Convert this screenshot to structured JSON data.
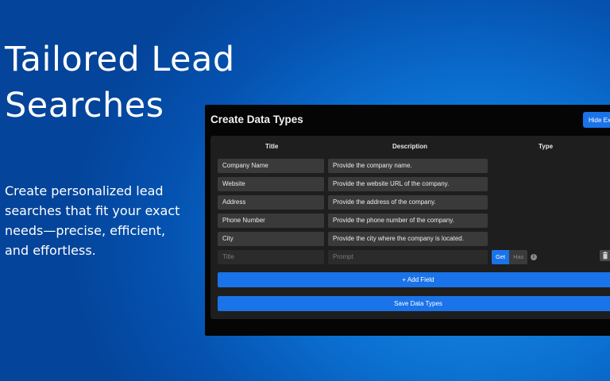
{
  "hero": {
    "title_line1": "Tailored Lead",
    "title_line2": "Searches",
    "desc_line1": "Create personalized lead",
    "desc_line2": "searches that fit your exact",
    "desc_line3": "needs—precise, efficient,",
    "desc_line4": "and effortless."
  },
  "panel": {
    "title": "Create Data Types",
    "hide_button": "Hide Ex",
    "columns": {
      "title": "Title",
      "description": "Description",
      "type": "Type"
    },
    "rows": [
      {
        "title": "Company Name",
        "description": "Provide the company name."
      },
      {
        "title": "Website",
        "description": "Provide the website URL of the company."
      },
      {
        "title": "Address",
        "description": "Provide the address of the company."
      },
      {
        "title": "Phone Number",
        "description": "Provide the phone number of the company."
      },
      {
        "title": "City",
        "description": "Provide the city where the company is located."
      }
    ],
    "new_row": {
      "title_placeholder": "Title",
      "prompt_placeholder": "Prompt",
      "type_options": [
        "Get",
        "Has"
      ],
      "selected_type": "Get"
    },
    "add_field_button": "+ Add Field",
    "save_button": "Save Data Types",
    "colors": {
      "accent": "#1a73e8",
      "panel_bg": "#050505",
      "card_bg": "#1e1e1e",
      "cell_bg": "#3a3a3a"
    },
    "icons": {
      "info": "info-icon",
      "delete": "trash-icon"
    }
  }
}
